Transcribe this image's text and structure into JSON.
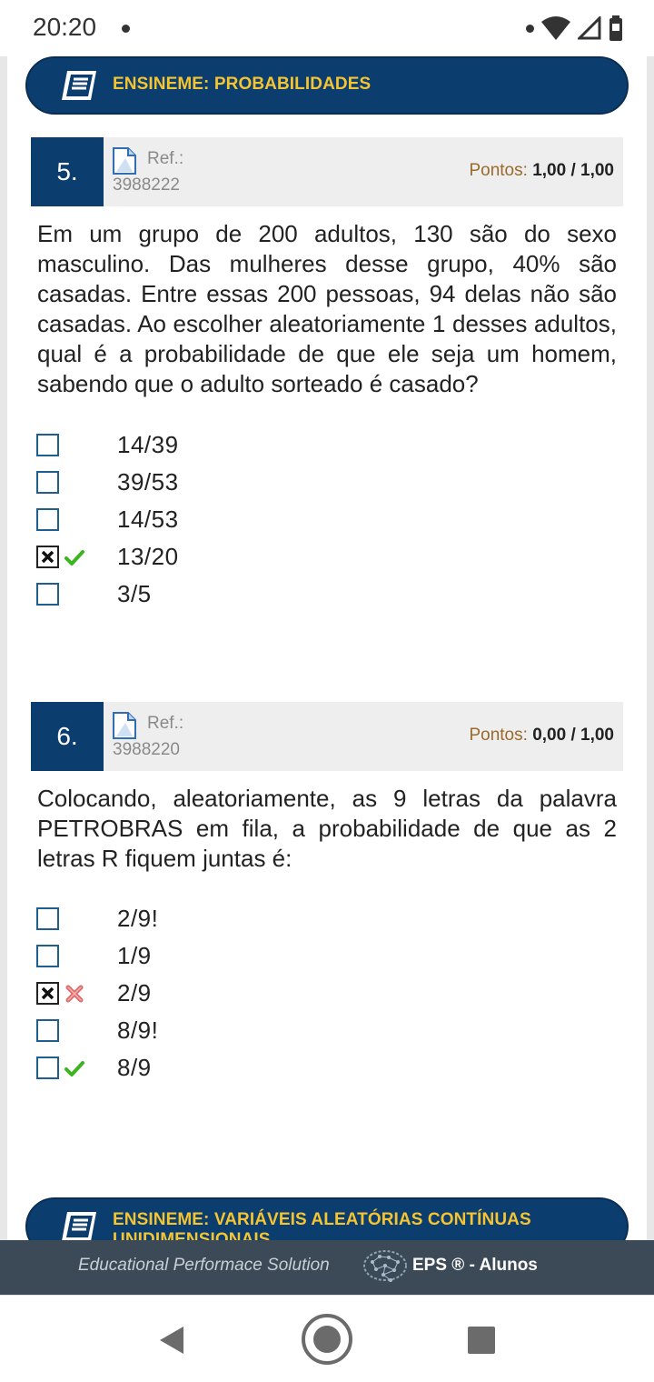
{
  "status": {
    "time": "20:20"
  },
  "sections": [
    {
      "title": "ENSINEME: PROBABILIDADES"
    },
    {
      "title": "ENSINEME: VARIÁVEIS ALEATÓRIAS CONTÍNUAS UNIDIMENSIONAIS"
    }
  ],
  "questions": [
    {
      "number": "5.",
      "ref_label": "Ref.:",
      "ref_code": "3988222",
      "points_label": "Pontos:",
      "points_value": "1,00",
      "points_max": "/ 1,00",
      "text": "Em um grupo de 200 adultos, 130 são do sexo masculino. Das mulheres desse grupo, 40% são casadas. Entre essas 200 pessoas, 94 delas não são casadas. Ao escolher aleatoriamente 1 desses adultos, qual é a probabilidade de que ele seja um homem, sabendo que o adulto sorteado é casado?",
      "options": [
        {
          "label": "14/39",
          "selected": false,
          "mark": "none"
        },
        {
          "label": "39/53",
          "selected": false,
          "mark": "none"
        },
        {
          "label": "14/53",
          "selected": false,
          "mark": "none"
        },
        {
          "label": "13/20",
          "selected": true,
          "mark": "correct"
        },
        {
          "label": "3/5",
          "selected": false,
          "mark": "none"
        }
      ]
    },
    {
      "number": "6.",
      "ref_label": "Ref.:",
      "ref_code": "3988220",
      "points_label": "Pontos:",
      "points_value": "0,00",
      "points_max": "/ 1,00",
      "text": "Colocando, aleatoriamente, as 9 letras da palavra PETROBRAS em fila, a probabilidade de que as 2 letras R fiquem juntas é:",
      "options": [
        {
          "label": "2/9!",
          "selected": false,
          "mark": "none"
        },
        {
          "label": "1/9",
          "selected": false,
          "mark": "none"
        },
        {
          "label": "2/9",
          "selected": true,
          "mark": "wrong"
        },
        {
          "label": "8/9!",
          "selected": false,
          "mark": "none"
        },
        {
          "label": "8/9",
          "selected": false,
          "mark": "correct"
        }
      ]
    }
  ],
  "footer": {
    "tagline": "Educational Performace Solution",
    "brand": "EPS ® - Alunos"
  },
  "colors": {
    "primary": "#0b3d6e",
    "accent": "#f5c431",
    "correct": "#3cb521",
    "wrong": "#e06a6a",
    "footer_bg": "#3c4a57"
  },
  "icons": {
    "section": "book-icon",
    "ref": "document-icon",
    "correct": "checkmark-icon",
    "wrong": "cross-icon",
    "footer": "brain-icon",
    "nav_back": "back-icon",
    "nav_home": "home-icon",
    "nav_recents": "recents-icon"
  }
}
